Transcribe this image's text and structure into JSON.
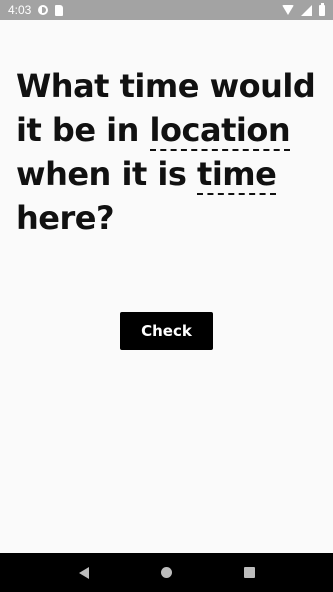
{
  "status_bar": {
    "time": "4:03",
    "left_icons": [
      "circle-half-icon",
      "sim-card-icon"
    ],
    "right_icons": [
      "wifi-icon",
      "signal-icon",
      "battery-icon"
    ]
  },
  "question": {
    "part1": "What time would it be in ",
    "location_label": "location",
    "part2": " when it is ",
    "time_label": "time",
    "part3": " here?"
  },
  "check_button": {
    "label": "Check"
  },
  "nav_bar": {
    "icons": [
      "back-icon",
      "home-icon",
      "recents-icon"
    ]
  },
  "colors": {
    "status_bar_bg": "#a3a3a3",
    "background": "#fafafa",
    "text": "#111111",
    "button_bg": "#000000",
    "button_text": "#ffffff",
    "nav_bar_bg": "#000000"
  }
}
